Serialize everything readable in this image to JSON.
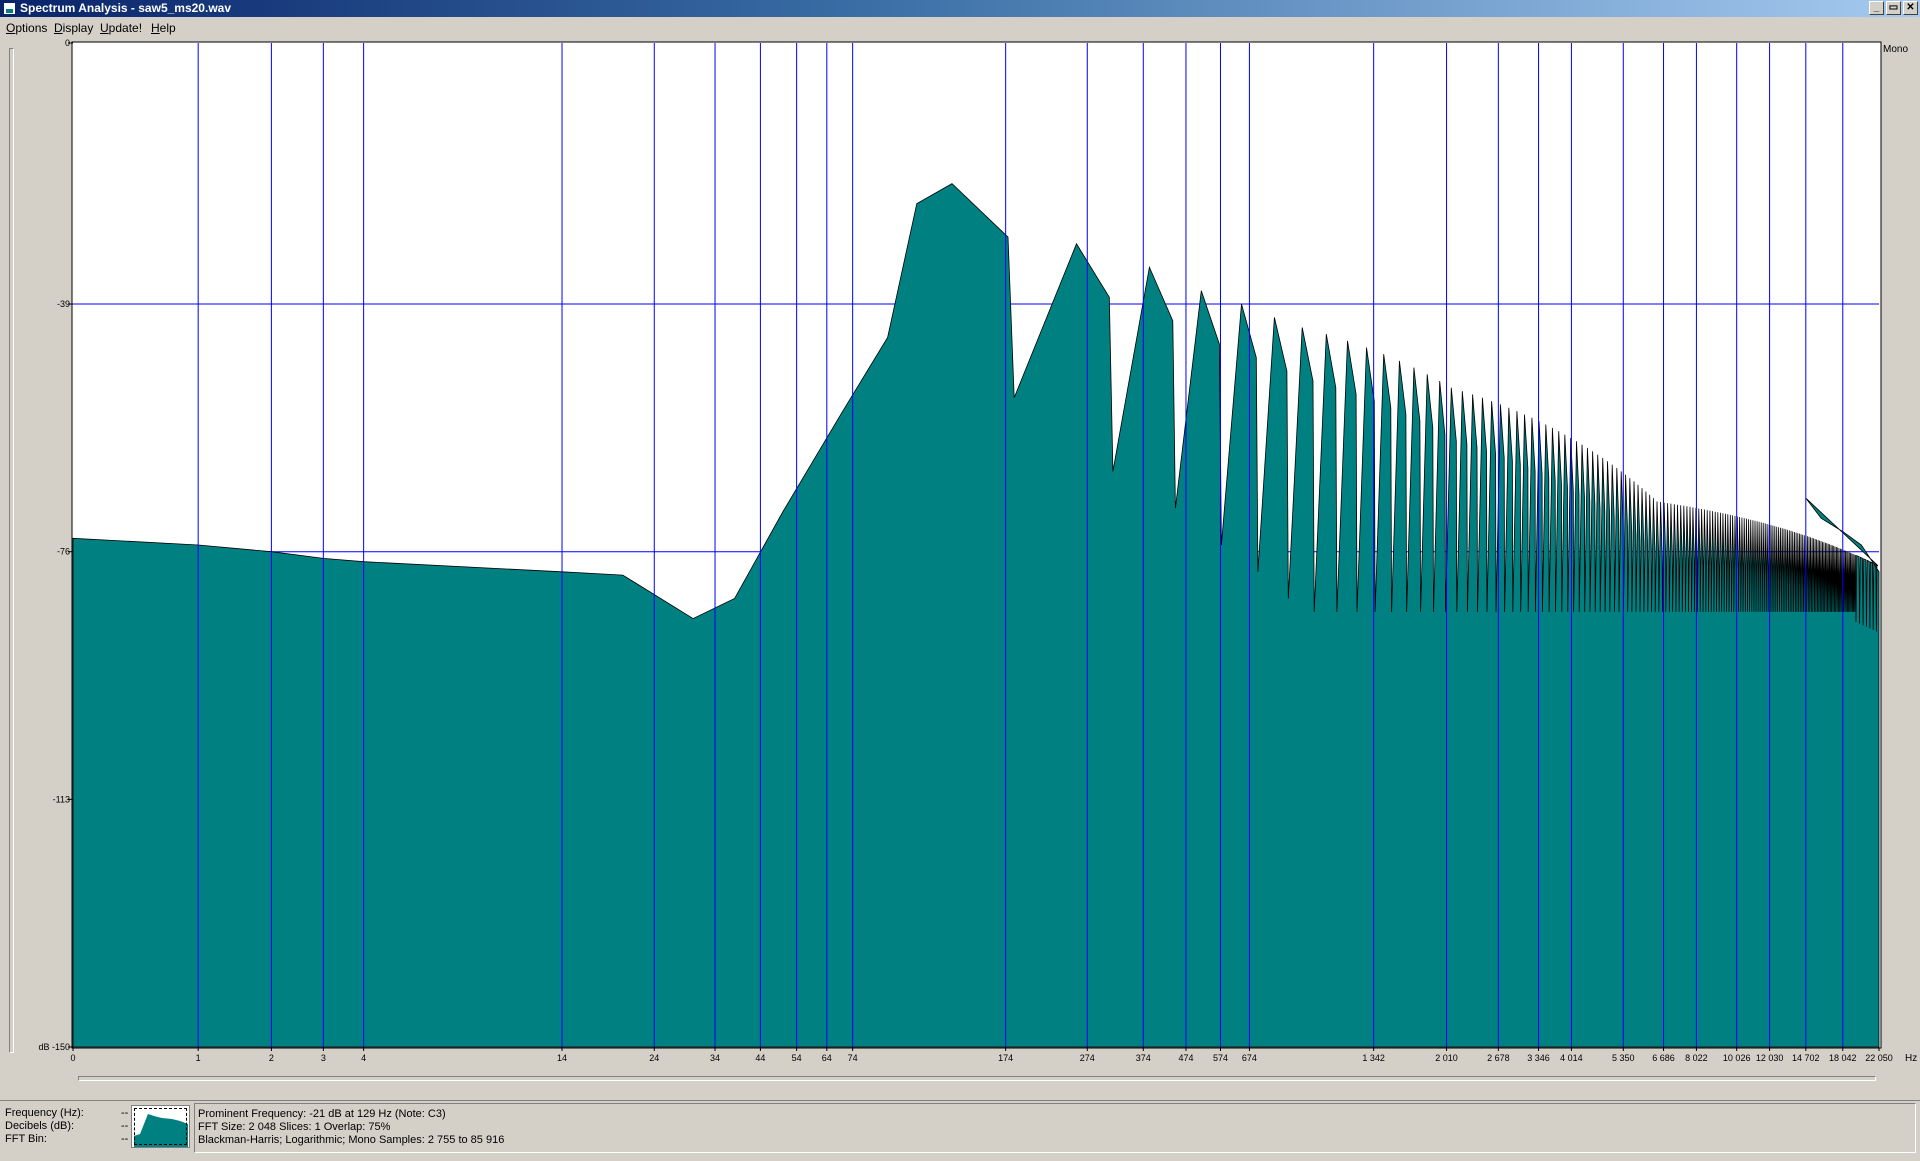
{
  "window": {
    "title": "Spectrum Analysis - saw5_ms20.wav",
    "buttons": [
      "_",
      "▭",
      "✕"
    ]
  },
  "menu": [
    {
      "label": "Options",
      "accel": "O",
      "rest": "ptions"
    },
    {
      "label": "Display",
      "accel": "D",
      "rest": "isplay"
    },
    {
      "label": "Update!",
      "accel": "U",
      "rest": "pdate!"
    },
    {
      "label": "Help",
      "accel": "H",
      "rest": "elp"
    }
  ],
  "channel_label": "Mono",
  "colors": {
    "fill": "#008080",
    "grid": "#0000ff",
    "background": "#ffffff"
  },
  "chart_data": {
    "type": "area",
    "xscale": "log",
    "yunit": "dB",
    "xunit": "Hz",
    "ylim": [
      -150,
      0
    ],
    "yticks": [
      "0",
      "-39",
      "-76",
      "-113",
      "dB -150"
    ],
    "ytick_values": [
      0,
      -39,
      -76,
      -113,
      -150
    ],
    "xticks": [
      "0",
      "1",
      "2",
      "3",
      "4",
      "14",
      "24",
      "34",
      "44",
      "54",
      "64",
      "74",
      "174",
      "274",
      "374",
      "474",
      "574",
      "674",
      "1 342",
      "2 010",
      "2 678",
      "3 346",
      "4 014",
      "5 350",
      "6 686",
      "8 022",
      "10 026",
      "12 030",
      "14 702",
      "18 042",
      "22 050"
    ],
    "xgrid": [
      "1",
      "2",
      "3",
      "4",
      "14",
      "24",
      "34",
      "44",
      "54",
      "64",
      "74",
      "174",
      "274",
      "374",
      "474",
      "574",
      "674",
      "1 342",
      "2 010",
      "2 678",
      "3 346",
      "4 014",
      "5 350",
      "6 686",
      "8 022",
      "10 026",
      "12 030",
      "14 702",
      "18 042"
    ],
    "ygrid": [
      "-39",
      "-76",
      "-113"
    ],
    "fundamental_hz": 129,
    "harmonic_peaks_db": [
      -21,
      -30,
      -33.5,
      -37,
      -39,
      -41,
      -42.5,
      -43.5,
      -44.5,
      -45.5,
      -46.5,
      -47.5,
      -48.5,
      -49.5,
      -50.5,
      -51.5,
      -52,
      -52.5,
      -53,
      -53.5,
      -54,
      -54.5,
      -55,
      -55.5,
      -56,
      -56.5,
      -57,
      -57.5,
      -58,
      -58.5,
      -59,
      -59.5,
      -60,
      -60.5,
      -61,
      -61.5,
      -62,
      -62.5,
      -63,
      -63.5,
      -64,
      -64.5,
      -65,
      -65.5,
      -66,
      -66.5,
      -67,
      -67.5,
      -68,
      -68.5
    ],
    "grid": true
  },
  "status": {
    "labels": [
      "Frequency (Hz):",
      "Decibels (dB):",
      "FFT Bin:"
    ],
    "dashes": [
      "--",
      "--",
      "--"
    ],
    "info": [
      "Prominent Frequency: -21 dB at 129 Hz (Note: C3)",
      "FFT Size: 2 048  Slices: 1  Overlap: 75%",
      "Blackman-Harris; Logarithmic; Mono  Samples: 2 755 to 85 916"
    ]
  }
}
